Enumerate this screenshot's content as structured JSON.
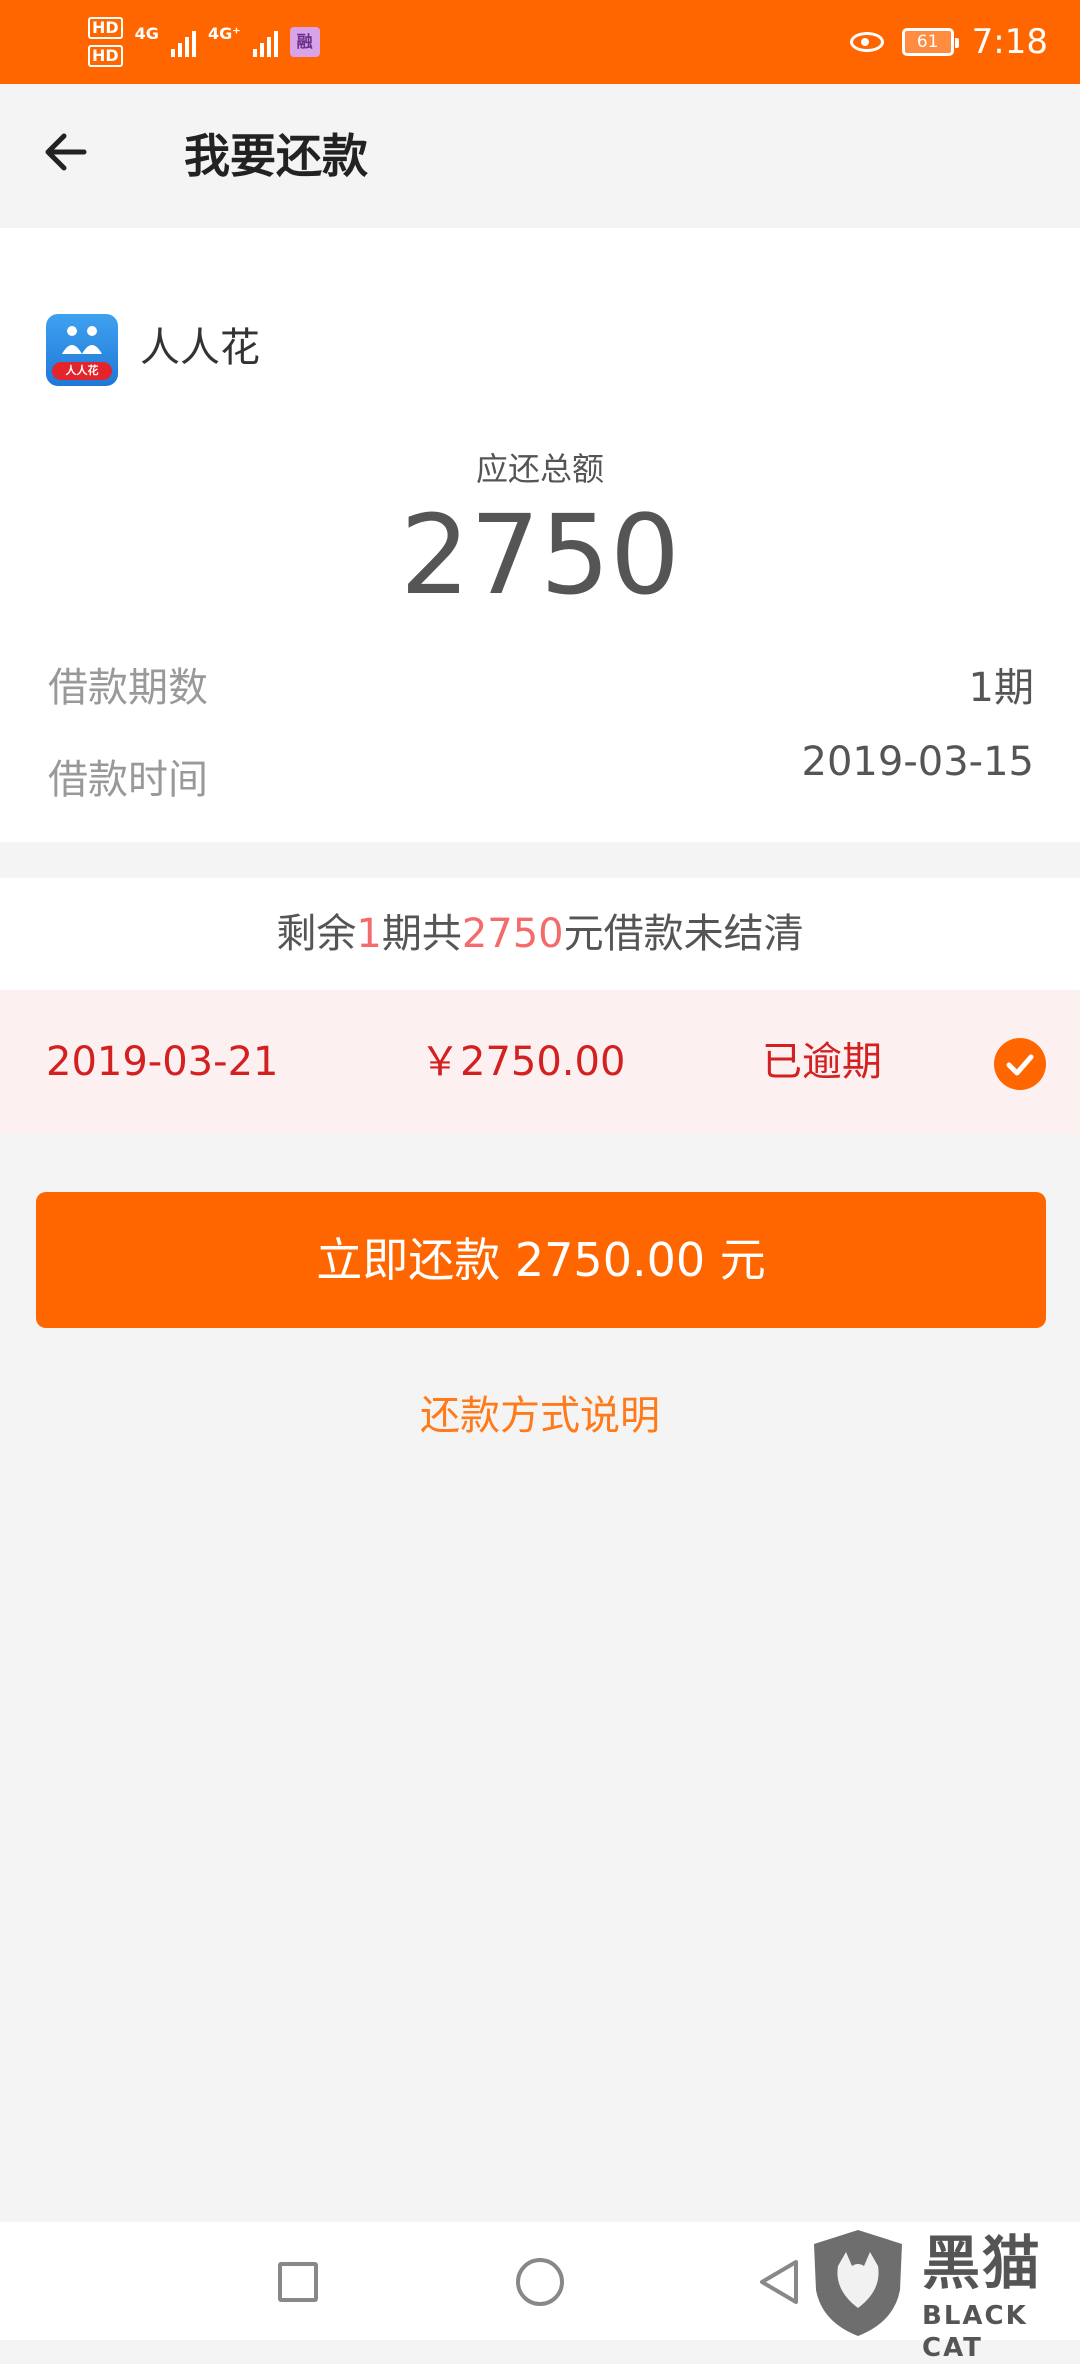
{
  "status_bar": {
    "hd1": "HD",
    "hd2": "HD",
    "net1": "4G",
    "net2": "4G⁺",
    "app_badge": "融",
    "battery": "61",
    "time": "7:18"
  },
  "header": {
    "title": "我要还款"
  },
  "loan": {
    "brand": "人人花",
    "logo_text": "人人花",
    "total_label": "应还总额",
    "total_value": "2750",
    "term_label": "借款期数",
    "term_value": "1期",
    "date_label": "借款时间",
    "date_value": "2019-03-15"
  },
  "remaining": {
    "prefix": "剩余",
    "periods": "1",
    "middle": "期共",
    "amount": "2750",
    "suffix": "元借款未结清"
  },
  "installment": {
    "date": "2019-03-21",
    "amount": "￥2750.00",
    "status": "已逾期",
    "selected": true
  },
  "actions": {
    "pay_button": "立即还款 2750.00 元",
    "method_link": "还款方式说明"
  },
  "watermark": {
    "cn": "黑猫",
    "en": "BLACK CAT"
  },
  "colors": {
    "accent": "#ff6600",
    "overdue": "#d32020",
    "highlight": "#f36b6b"
  }
}
